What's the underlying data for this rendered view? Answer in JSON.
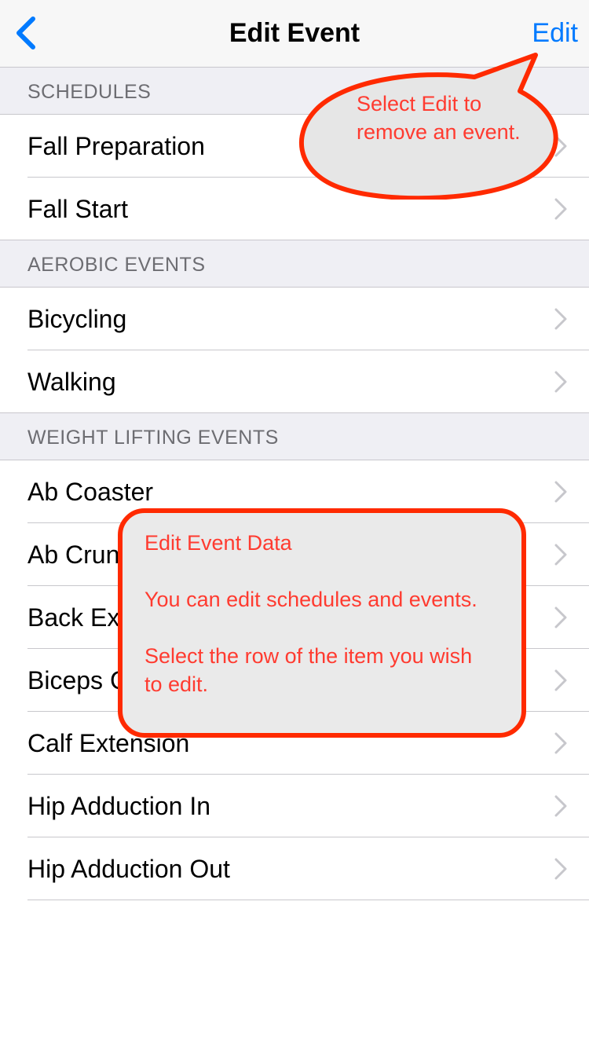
{
  "navbar": {
    "title": "Edit Event",
    "edit_label": "Edit",
    "back_icon": "chevron-left-icon",
    "accent_color": "#007aff"
  },
  "sections": [
    {
      "header": "SCHEDULES",
      "items": [
        "Fall Preparation",
        "Fall Start"
      ]
    },
    {
      "header": "AEROBIC EVENTS",
      "items": [
        "Bicycling",
        "Walking"
      ]
    },
    {
      "header": "WEIGHT LIFTING EVENTS",
      "items": [
        "Ab Coaster",
        "Ab Crunch",
        "Back Extension",
        "Biceps Curl",
        "Calf Extension",
        "Hip Adduction In",
        "Hip Adduction Out"
      ]
    }
  ],
  "callouts": {
    "edit_hint": "Select Edit to remove an event.",
    "info_title": "Edit Event Data",
    "info_line1": "You can edit schedules and events.",
    "info_line2": "Select the row of the item you wish to edit.",
    "color": "#ff3b30"
  }
}
